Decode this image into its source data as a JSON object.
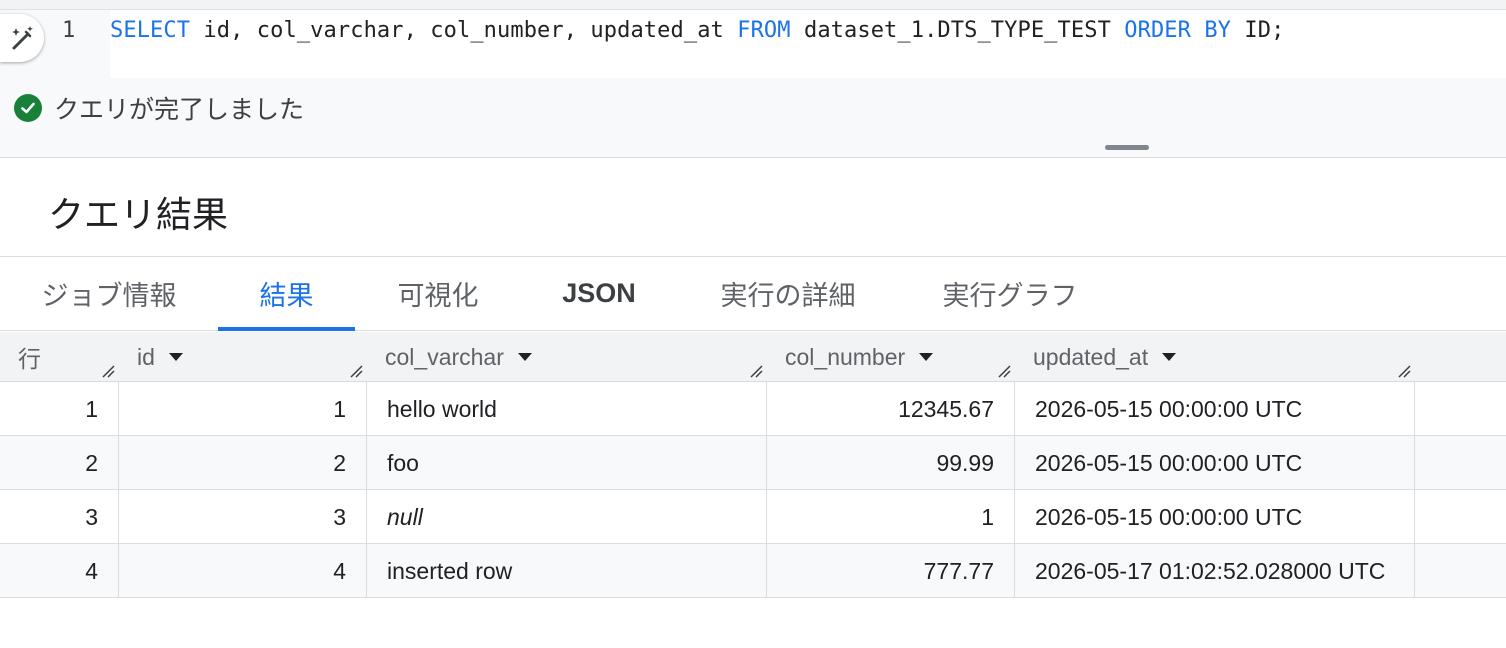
{
  "editor": {
    "line_number": "1",
    "sql": {
      "kw_select": "SELECT",
      "columns": " id, col_varchar, col_number, updated_at ",
      "kw_from": "FROM",
      "table": " dataset_1.DTS_TYPE_TEST ",
      "kw_order_by": "ORDER BY",
      "tail": " ID;"
    },
    "status_text": "クエリが完了しました"
  },
  "results": {
    "title": "クエリ結果",
    "tabs": [
      {
        "label": "ジョブ情報"
      },
      {
        "label": "結果"
      },
      {
        "label": "可視化"
      },
      {
        "label": "JSON"
      },
      {
        "label": "実行の詳細"
      },
      {
        "label": "実行グラフ"
      }
    ],
    "active_tab": "結果",
    "columns": {
      "row": "行",
      "id": "id",
      "col_varchar": "col_varchar",
      "col_number": "col_number",
      "updated_at": "updated_at"
    },
    "rows": [
      {
        "row": "1",
        "id": "1",
        "col_varchar": "hello world",
        "col_number": "12345.67",
        "updated_at": "2026-05-15 00:00:00 UTC"
      },
      {
        "row": "2",
        "id": "2",
        "col_varchar": "foo",
        "col_number": "99.99",
        "updated_at": "2026-05-15 00:00:00 UTC"
      },
      {
        "row": "3",
        "id": "3",
        "col_varchar": "null",
        "col_number": "1",
        "updated_at": "2026-05-15 00:00:00 UTC"
      },
      {
        "row": "4",
        "id": "4",
        "col_varchar": "inserted row",
        "col_number": "777.77",
        "updated_at": "2026-05-17 01:02:52.028000 UTC"
      }
    ]
  },
  "colors": {
    "accent": "#1a73e8",
    "success": "#188038"
  },
  "icons": {
    "assist": "sparkle-pen-icon",
    "status": "check-circle-icon",
    "sort": "arrow-drop-down-icon",
    "resize": "column-resize-icon"
  }
}
